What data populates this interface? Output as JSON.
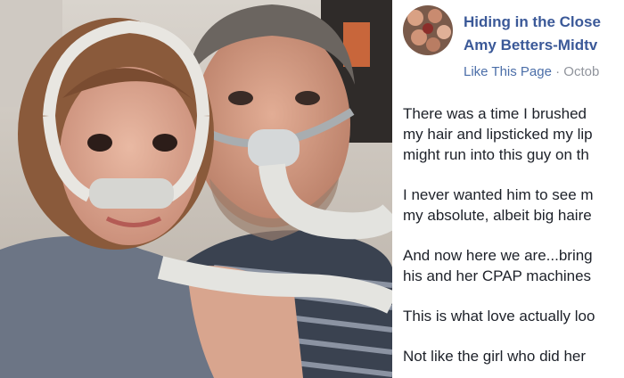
{
  "post": {
    "group_name": "Hiding in the Close",
    "author_name": "Amy Betters-Midtv",
    "like_page": "Like This Page",
    "meta_separator": " · ",
    "date": "Octob",
    "paragraphs": [
      [
        "There was a time I brushed",
        "my hair and lipsticked my lip",
        "might run into this guy on th"
      ],
      [
        "I never wanted him to see m",
        "my absolute, albeit big haire"
      ],
      [
        "And now here we are...bring",
        "his and her CPAP machines"
      ],
      [
        "This is what love actually loo"
      ],
      [
        "Not like the girl who did her"
      ]
    ]
  },
  "colors": {
    "link": "#3b5998",
    "meta": "#90949c",
    "text": "#1d2129"
  }
}
